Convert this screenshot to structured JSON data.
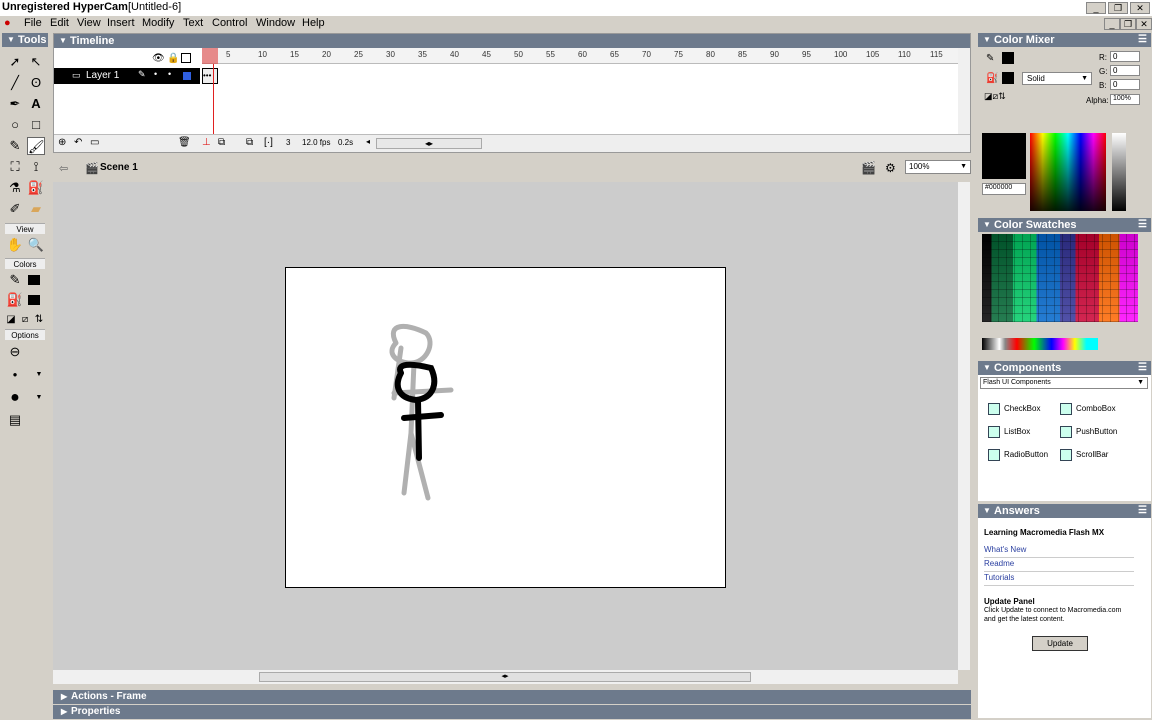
{
  "window": {
    "title_app": "Unregistered HyperCam",
    "title_doc": "[Untitled-6]"
  },
  "menu": [
    "File",
    "Edit",
    "View",
    "Insert",
    "Modify",
    "Text",
    "Control",
    "Window",
    "Help"
  ],
  "tools": {
    "header": "Tools",
    "view_label": "View",
    "colors_label": "Colors",
    "options_label": "Options"
  },
  "timeline": {
    "title": "Timeline",
    "layer_name": "Layer 1",
    "frame_numbers": [
      "5",
      "10",
      "15",
      "20",
      "25",
      "30",
      "35",
      "40",
      "45",
      "50",
      "55",
      "60",
      "65",
      "70",
      "75",
      "80",
      "85",
      "90",
      "95",
      "100",
      "105",
      "110",
      "115"
    ],
    "current_frame": "3",
    "frame_rate": "12.0 fps",
    "elapsed": "0.2s"
  },
  "scene": {
    "name": "Scene 1",
    "zoom": "100%"
  },
  "color_mixer": {
    "title": "Color Mixer",
    "fill_type": "Solid",
    "r_label": "R:",
    "r": "0",
    "g_label": "G:",
    "g": "0",
    "b_label": "B:",
    "b": "0",
    "alpha_label": "Alpha:",
    "alpha": "100%",
    "hex": "#000000"
  },
  "color_swatches": {
    "title": "Color Swatches"
  },
  "components": {
    "title": "Components",
    "set": "Flash UI Components",
    "items": [
      {
        "label": "CheckBox",
        "icon": "checkbox-icon"
      },
      {
        "label": "ComboBox",
        "icon": "combobox-icon"
      },
      {
        "label": "ListBox",
        "icon": "listbox-icon"
      },
      {
        "label": "PushButton",
        "icon": "pushbutton-icon"
      },
      {
        "label": "RadioButton",
        "icon": "radiobutton-icon"
      },
      {
        "label": "ScrollBar",
        "icon": "scrollbar-icon"
      }
    ]
  },
  "answers": {
    "title": "Answers",
    "heading": "Learning Macromedia Flash MX",
    "links": [
      "What's New",
      "Readme",
      "Tutorials"
    ],
    "update_title": "Update Panel",
    "update_text_1": "Click Update to connect to Macromedia.com",
    "update_text_2": "and get the latest content.",
    "update_button": "Update"
  },
  "bottom_panels": [
    "Actions - Frame",
    "Properties"
  ],
  "colors": {
    "panel_header": "#6d7a8c",
    "stage_bg": "#cccccc",
    "playhead": "#e02020"
  }
}
